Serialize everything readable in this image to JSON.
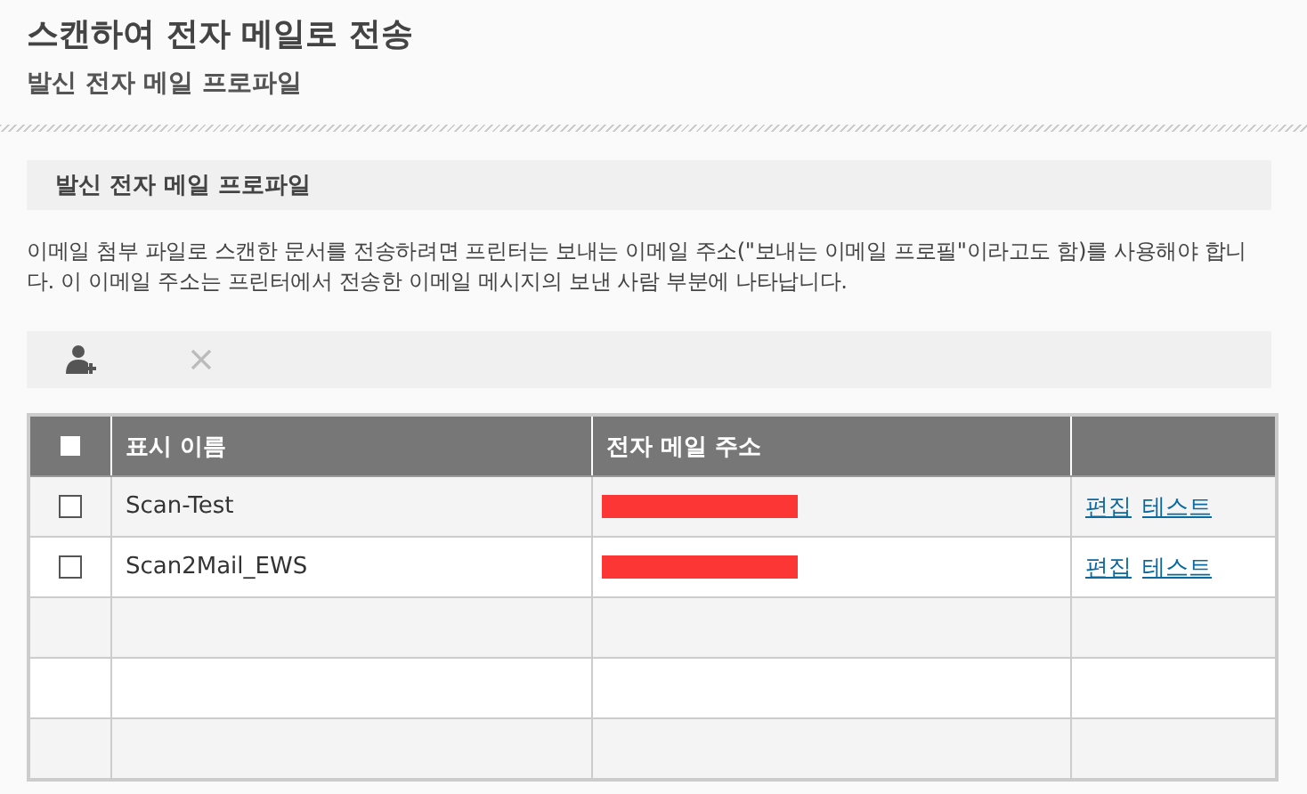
{
  "page": {
    "title": "스캔하여 전자 메일로 전송",
    "subtitle": "발신 전자 메일 프로파일"
  },
  "section": {
    "title": "발신 전자 메일 프로파일",
    "description": "이메일 첨부 파일로 스캔한 문서를 전송하려면 프린터는 보내는 이메일 주소(\"보내는 이메일 프로필\"이라고도 함)를 사용해야 합니다. 이 이메일 주소는 프린터에서 전송한 이메일 메시지의 보낸 사람 부분에 나타납니다."
  },
  "toolbar": {
    "delete_disabled": true
  },
  "table": {
    "all_checked": false,
    "columns": [
      "표시 이름",
      "전자 메일 주소"
    ],
    "rows": [
      {
        "checked": false,
        "name": "Scan-Test",
        "actions": [
          "편집",
          "테스트"
        ]
      },
      {
        "checked": false,
        "name": "Scan2Mail_EWS",
        "actions": [
          "편집",
          "테스트"
        ]
      }
    ]
  }
}
